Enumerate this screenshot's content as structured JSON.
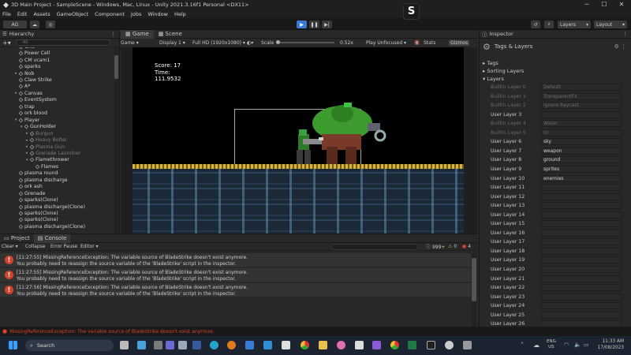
{
  "window": {
    "title": "3D Main Project - SampleScene - Windows, Mac, Linux - Unity 2021.3.16f1 Personal <DX11>"
  },
  "menu": [
    "File",
    "Edit",
    "Assets",
    "GameObject",
    "Component",
    "Jobs",
    "Window",
    "Help"
  ],
  "toolbar": {
    "account": "AG",
    "layers": "Layers",
    "layout": "Layout"
  },
  "hierarchy": {
    "tab": "Hierarchy",
    "search_placeholder": "All",
    "items": [
      {
        "label": "Grid",
        "indent": 1,
        "dim": false,
        "arrow": "▸"
      },
      {
        "label": "Power Cell",
        "indent": 1,
        "dim": false,
        "arrow": ""
      },
      {
        "label": "CM vcam1",
        "indent": 1,
        "dim": false,
        "arrow": ""
      },
      {
        "label": "sparks",
        "indent": 1,
        "dim": false,
        "arrow": ""
      },
      {
        "label": "Nob",
        "indent": 1,
        "dim": false,
        "arrow": "▸"
      },
      {
        "label": "Claw Strike",
        "indent": 1,
        "dim": false,
        "arrow": ""
      },
      {
        "label": "A*",
        "indent": 1,
        "dim": false,
        "arrow": ""
      },
      {
        "label": "Canvas",
        "indent": 1,
        "dim": false,
        "arrow": "▸"
      },
      {
        "label": "EventSystem",
        "indent": 1,
        "dim": false,
        "arrow": ""
      },
      {
        "label": "trap",
        "indent": 1,
        "dim": false,
        "arrow": ""
      },
      {
        "label": "ork blood",
        "indent": 1,
        "dim": false,
        "arrow": ""
      },
      {
        "label": "Player",
        "indent": 1,
        "dim": false,
        "arrow": "▾"
      },
      {
        "label": "GunHolder",
        "indent": 2,
        "dim": false,
        "arrow": "▾"
      },
      {
        "label": "Burgun",
        "indent": 3,
        "dim": true,
        "arrow": "▸"
      },
      {
        "label": "Heavy Bolter",
        "indent": 3,
        "dim": true,
        "arrow": "▸"
      },
      {
        "label": "Plasma Gun",
        "indent": 3,
        "dim": true,
        "arrow": "▸"
      },
      {
        "label": "Grenade Launcher",
        "indent": 3,
        "dim": true,
        "arrow": "▸"
      },
      {
        "label": "Flamethrower",
        "indent": 3,
        "dim": false,
        "arrow": "▾"
      },
      {
        "label": "Flames",
        "indent": 4,
        "dim": false,
        "arrow": ""
      },
      {
        "label": "plasma round",
        "indent": 1,
        "dim": false,
        "arrow": ""
      },
      {
        "label": "plasma discharge",
        "indent": 1,
        "dim": false,
        "arrow": ""
      },
      {
        "label": "ork ash",
        "indent": 1,
        "dim": false,
        "arrow": ""
      },
      {
        "label": "Grenade",
        "indent": 1,
        "dim": false,
        "arrow": ""
      },
      {
        "label": "sparks(Clone)",
        "indent": 1,
        "dim": false,
        "arrow": ""
      },
      {
        "label": "plasma discharge(Clone)",
        "indent": 1,
        "dim": false,
        "arrow": ""
      },
      {
        "label": "sparks(Clone)",
        "indent": 1,
        "dim": false,
        "arrow": ""
      },
      {
        "label": "sparks(Clone)",
        "indent": 1,
        "dim": false,
        "arrow": ""
      },
      {
        "label": "plasma discharge(Clone)",
        "indent": 1,
        "dim": false,
        "arrow": ""
      }
    ]
  },
  "game": {
    "tabs": [
      "Game",
      "Scene"
    ],
    "mode": "Game",
    "display": "Display 1",
    "resolution": "Full HD (1920x1080)",
    "scale_label": "Scale",
    "scale_value": "0.52x",
    "play_focus": "Play Unfocused",
    "stats": "Stats",
    "gizmos": "Gizmos",
    "hud": {
      "score": "Score: 17",
      "time_label": "Time:",
      "time_value": "111.9532"
    }
  },
  "console": {
    "tabs": [
      "Project",
      "Console"
    ],
    "clear": "Clear",
    "collapse": "Collapse",
    "error_pause": "Error Pause",
    "editor": "Editor",
    "counts": {
      "info": "999+",
      "warn": "0",
      "error": "4"
    },
    "logs": [
      {
        "line1": "[11:27:55] MissingReferenceException: The variable source of BladeStrike doesn't exist anymore.",
        "line2": "You probably need to reassign the source variable of the 'BladeStrike' script in the inspector."
      },
      {
        "line1": "[11:27:55] MissingReferenceException: The variable source of BladeStrike doesn't exist anymore.",
        "line2": "You probably need to reassign the source variable of the 'BladeStrike' script in the inspector."
      },
      {
        "line1": "[11:27:56] MissingReferenceException: The variable source of BladeStrike doesn't exist anymore.",
        "line2": "You probably need to reassign the source variable of the 'BladeStrike' script in the inspector."
      }
    ]
  },
  "inspector": {
    "tab": "Inspector",
    "title": "Tags & Layers",
    "sections": [
      "Tags",
      "Sorting Layers",
      "Layers"
    ],
    "layers": [
      {
        "name": "Builtin Layer 0",
        "value": "Default",
        "disabled": true
      },
      {
        "name": "Builtin Layer 1",
        "value": "TransparentFX",
        "disabled": true
      },
      {
        "name": "Builtin Layer 2",
        "value": "Ignore Raycast",
        "disabled": true
      },
      {
        "name": "User Layer 3",
        "value": "",
        "disabled": false
      },
      {
        "name": "Builtin Layer 4",
        "value": "Water",
        "disabled": true
      },
      {
        "name": "Builtin Layer 5",
        "value": "UI",
        "disabled": true
      },
      {
        "name": "User Layer 6",
        "value": "sky",
        "disabled": false
      },
      {
        "name": "User Layer 7",
        "value": "weapon",
        "disabled": false
      },
      {
        "name": "User Layer 8",
        "value": "ground",
        "disabled": false
      },
      {
        "name": "User Layer 9",
        "value": "sprites",
        "disabled": false
      },
      {
        "name": "User Layer 10",
        "value": "enemies",
        "disabled": false
      },
      {
        "name": "User Layer 11",
        "value": "",
        "disabled": false
      },
      {
        "name": "User Layer 12",
        "value": "",
        "disabled": false
      },
      {
        "name": "User Layer 13",
        "value": "",
        "disabled": false
      },
      {
        "name": "User Layer 14",
        "value": "",
        "disabled": false
      },
      {
        "name": "User Layer 15",
        "value": "",
        "disabled": false
      },
      {
        "name": "User Layer 16",
        "value": "",
        "disabled": false
      },
      {
        "name": "User Layer 17",
        "value": "",
        "disabled": false
      },
      {
        "name": "User Layer 18",
        "value": "",
        "disabled": false
      },
      {
        "name": "User Layer 19",
        "value": "",
        "disabled": false
      },
      {
        "name": "User Layer 20",
        "value": "",
        "disabled": false
      },
      {
        "name": "User Layer 21",
        "value": "",
        "disabled": false
      },
      {
        "name": "User Layer 22",
        "value": "",
        "disabled": false
      },
      {
        "name": "User Layer 23",
        "value": "",
        "disabled": false
      },
      {
        "name": "User Layer 24",
        "value": "",
        "disabled": false
      },
      {
        "name": "User Layer 25",
        "value": "",
        "disabled": false
      },
      {
        "name": "User Layer 26",
        "value": "",
        "disabled": false
      }
    ]
  },
  "status": {
    "message": "MissingReferenceException: The variable source of BladeStrike doesn't exist anymore."
  },
  "taskbar": {
    "search": "Search",
    "lang": "ENG",
    "region": "US",
    "time": "11:33 AM",
    "date": "17/08/2023"
  },
  "colors": {
    "error": "#d4432b",
    "play_active": "#3a79d6",
    "accent": "#2c5d87"
  }
}
